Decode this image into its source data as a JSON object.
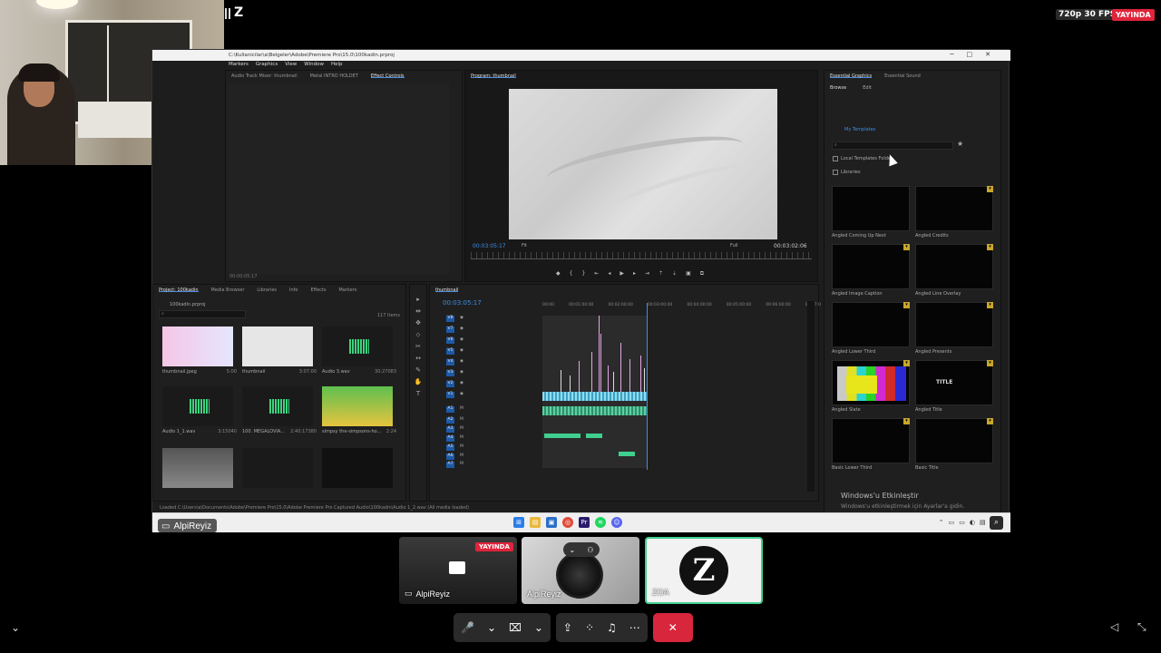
{
  "top": {
    "stream_quality": "720p 30 FPS",
    "live_badge": "YAYINDA",
    "server_logo": "Z"
  },
  "premiere": {
    "title_path": "C:\\Kullanicilar\\a\\Belgeler\\Adobe\\Premiere Pro\\15.0\\100kadin.prproj",
    "menu": [
      "Markers",
      "Graphics",
      "View",
      "Window",
      "Help"
    ],
    "effect_tabs": [
      "Audio Track Mixer: thumbnail",
      "Metal INTRO HOLDET",
      "Effect Controls"
    ],
    "effect_timestamp": "00:00:05:17",
    "program": {
      "tab": "Program: thumbnail",
      "timecode_left": "00:03:05:17",
      "fit": "Fit",
      "quality": "Full",
      "timecode_right": "00:03:02:06"
    },
    "essential": {
      "tabs": [
        "Essential Graphics",
        "Essential Sound"
      ],
      "subtabs": [
        "Browse",
        "Edit"
      ],
      "my_templates": "My Templates",
      "check_local": "Local Templates Folder",
      "check_libraries": "Libraries",
      "templates": [
        {
          "label": "Angled Coming Up Next"
        },
        {
          "label": "Angled Credits"
        },
        {
          "label": "Angled Image Caption"
        },
        {
          "label": "Angled Line Overlay"
        },
        {
          "label": "Angled Lower Third"
        },
        {
          "label": "Angled Presents"
        },
        {
          "label": "Angled Slate"
        },
        {
          "label": "Angled Title",
          "thumb_text": "TITLE"
        },
        {
          "label": "Basic Lower Third"
        },
        {
          "label": "Basic Title"
        }
      ],
      "watermark_title": "Windows'u Etkinleştir",
      "watermark_sub": "Windows'u etkinleştirmek için Ayarlar'a gidin."
    },
    "project": {
      "tabs": [
        "Project: 100kadin",
        "Media Browser",
        "Libraries",
        "Info",
        "Effects",
        "Markers"
      ],
      "file": "100kadin.prproj",
      "count": "117 Items",
      "assets": [
        {
          "name": "thumbnail.jpeg",
          "dur": "5:00"
        },
        {
          "name": "thumbnail",
          "dur": "3:07:00"
        },
        {
          "name": "Audio 3.wav",
          "dur": "30:27083"
        },
        {
          "name": "Audio 1_1.wav",
          "dur": "3:15040"
        },
        {
          "name": "100. MEGALOVIA...",
          "dur": "2:40:17380"
        },
        {
          "name": "simpsy the-simpsons-ho...",
          "dur": "2:24"
        },
        {
          "name": "",
          "dur": ""
        },
        {
          "name": "",
          "dur": ""
        },
        {
          "name": "",
          "dur": ""
        }
      ]
    },
    "tools": [
      "▸",
      "⇹",
      "✥",
      "⬦",
      "✂",
      "↔",
      "✎",
      "✋",
      "T"
    ],
    "timeline": {
      "tab": "thumbnail",
      "timecode": "00:03:05:17",
      "ruler": [
        "00:00",
        "00:01:00:00",
        "00:02:00:00",
        "00:03:00:00",
        "00:04:00:00",
        "00:05:00:00",
        "00:06:00:00",
        "00:07:0"
      ],
      "video_tracks": [
        "V8",
        "V7",
        "V6",
        "V5",
        "V4",
        "V3",
        "V2",
        "V1"
      ],
      "audio_tracks": [
        "A1",
        "A2",
        "A3",
        "A4",
        "A5",
        "A6",
        "A7"
      ]
    },
    "status": "Loaded C:\\Users\\a\\Documents\\Adobe\\Premiere Pro\\15.0\\Adobe Premiere Pro Captured Audio\\100kadin\\Audio 1_2.wav (All media loaded)"
  },
  "share": {
    "presenter": "AlpiReyiz"
  },
  "participants": [
    {
      "name": "AlpiReyiz",
      "live": "YAYINDA"
    },
    {
      "name": "AlpiReyiz"
    },
    {
      "name": "ZOA",
      "logo": "Z"
    }
  ],
  "controls": {
    "mic": "🎤",
    "camera": "⌧",
    "share": "⇪",
    "activities": "⁘",
    "soundboard": "♫",
    "more": "⋯",
    "leave": "✕"
  },
  "colors": {
    "live_red": "#e0243a",
    "leave_red": "#d8263c",
    "premiere_blue": "#3b8fe8",
    "speaking_green": "#3fcf8f"
  }
}
